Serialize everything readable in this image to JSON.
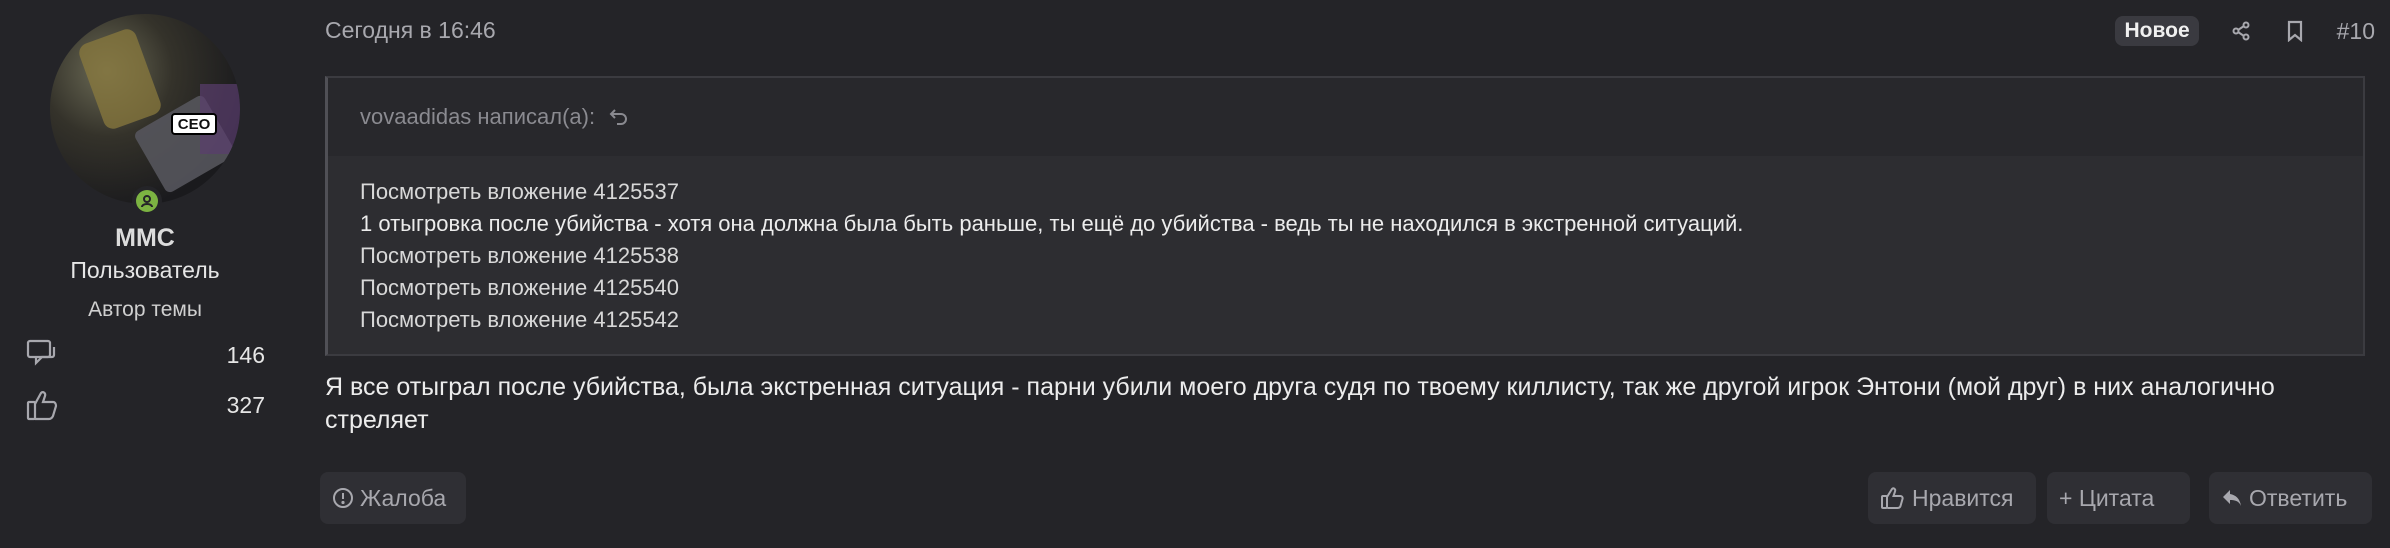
{
  "user": {
    "avatar_badge": "CEO",
    "name": "MMC",
    "role": "Пользователь",
    "badge": "Автор темы",
    "stats": [
      {
        "icon": "messages-icon",
        "value": "146"
      },
      {
        "icon": "thumbs-up-icon",
        "value": "327"
      }
    ]
  },
  "post": {
    "date": "Сегодня в 16:46",
    "new_badge": "Новое",
    "number": "#10",
    "quote": {
      "author_line": "vovaadidas написал(а):",
      "lines": [
        "Посмотреть вложение 4125537",
        "1 отыгровка после убийства - хотя она должна была быть раньше, ты ещё до убийства - ведь ты не находился в экстренной ситуаций.",
        "Посмотреть вложение 4125538",
        "Посмотреть вложение 4125540",
        "Посмотреть вложение 4125542"
      ]
    },
    "text": "Я все отыграл после убийства, была экстренная ситуация - парни убили моего друга судя по твоему киллисту, так же другой игрок Энтони (мой друг) в них аналогично стреляет"
  },
  "actions": {
    "report": "Жалоба",
    "like": "Нравится",
    "quote": "+ Цитата",
    "reply": "Ответить"
  },
  "colors": {
    "background": "#242428",
    "online": "#7cb342"
  }
}
